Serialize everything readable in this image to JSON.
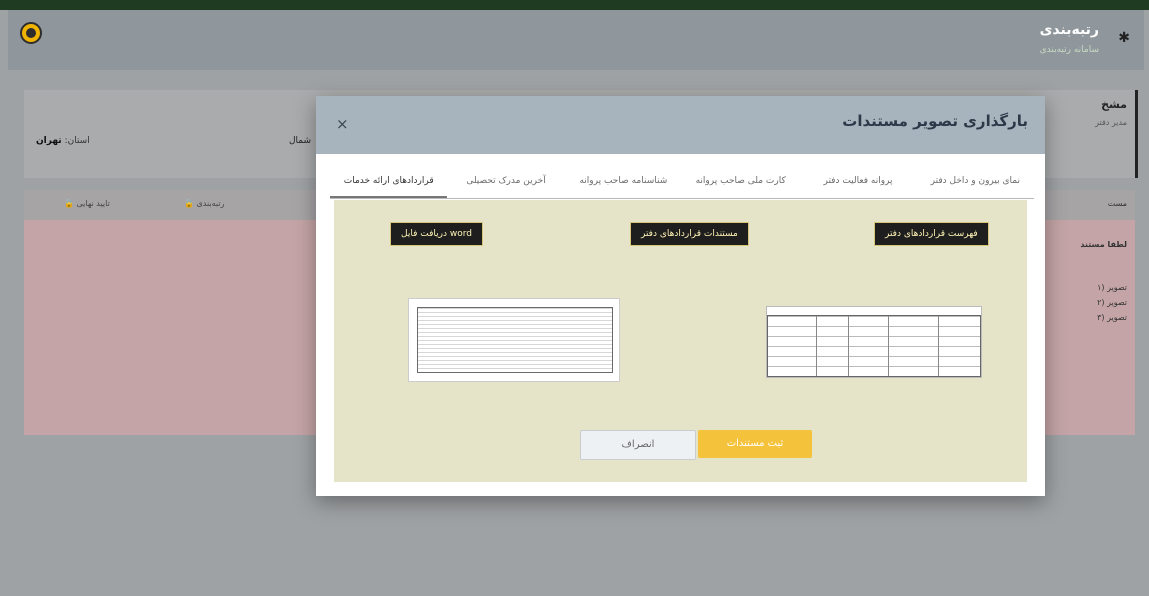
{
  "header": {
    "title": "رتبه‌بندی",
    "subtitle": "سامانه رتبه‌بندی"
  },
  "page": {
    "info_title": "مشخ",
    "info_sub": "مدیر دفتر",
    "province_label": "استان:",
    "province_value": "تهران",
    "city_label": "شمال",
    "tabs": [
      {
        "label": "تایید نهایی"
      },
      {
        "label": "رتبه‌بندی"
      }
    ],
    "status_tab": "مست",
    "panel_head": "لطفا مستند",
    "panel_items": [
      "۱) تصویر",
      "۲) تصویر",
      "۳) تصویر"
    ]
  },
  "modal": {
    "title": "بارگذاری تصویر مستندات",
    "close": "×",
    "tabs": [
      {
        "label": "نمای بیرون و داخل دفتر",
        "active": false
      },
      {
        "label": "پروانه فعالیت دفتر",
        "active": false
      },
      {
        "label": "کارت ملی صاحب پروانه",
        "active": false
      },
      {
        "label": "شناسنامه صاحب پروانه",
        "active": false
      },
      {
        "label": "آخرین مدرک تحصیلی",
        "active": false
      },
      {
        "label": "قراردادهای ارائه خدمات",
        "active": true
      }
    ],
    "buttons": {
      "list_contracts": "فهرست قراردادهای دفتر",
      "contract_docs": "مستندات قراردادهای دفتر",
      "download_word": "دریافت فایل word"
    },
    "actions": {
      "submit": "ثبت مستندات",
      "cancel": "انصراف"
    }
  }
}
